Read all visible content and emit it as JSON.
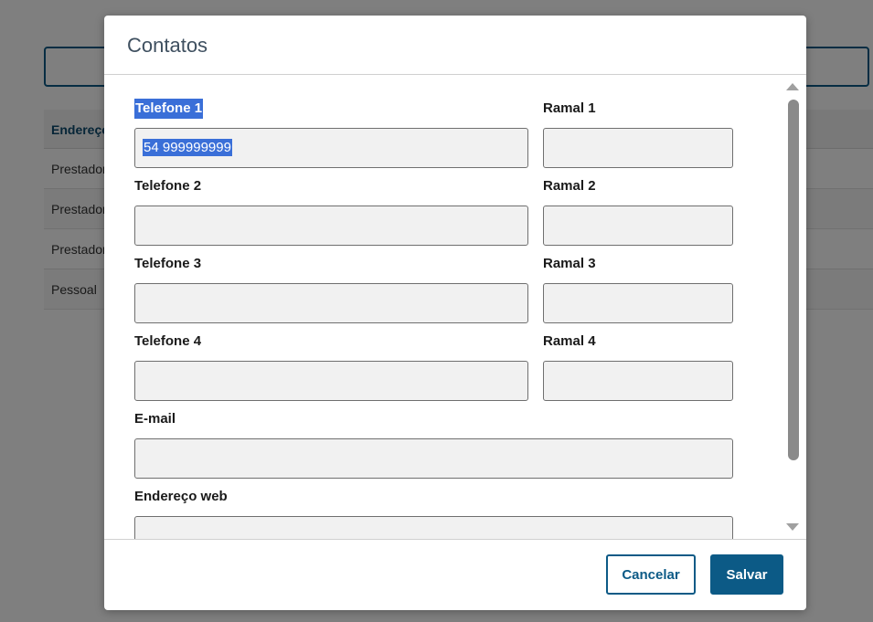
{
  "background": {
    "table_header": "Endereço",
    "rows": [
      "Prestador",
      "Prestador",
      "Prestador",
      "Pessoal"
    ]
  },
  "modal": {
    "title": "Contatos",
    "fields": {
      "telefone1": {
        "label": "Telefone 1",
        "value": "54 999999999"
      },
      "ramal1": {
        "label": "Ramal 1",
        "value": ""
      },
      "telefone2": {
        "label": "Telefone 2",
        "value": ""
      },
      "ramal2": {
        "label": "Ramal 2",
        "value": ""
      },
      "telefone3": {
        "label": "Telefone 3",
        "value": ""
      },
      "ramal3": {
        "label": "Ramal 3",
        "value": ""
      },
      "telefone4": {
        "label": "Telefone 4",
        "value": ""
      },
      "ramal4": {
        "label": "Ramal 4",
        "value": ""
      },
      "email": {
        "label": "E-mail",
        "value": ""
      },
      "endereco_web": {
        "label": "Endereço web",
        "value": ""
      }
    },
    "buttons": {
      "cancel": "Cancelar",
      "save": "Salvar"
    }
  },
  "colors": {
    "primary": "#0c5a86",
    "selection": "#3a6fd8",
    "input_bg": "#f1f1f1"
  }
}
